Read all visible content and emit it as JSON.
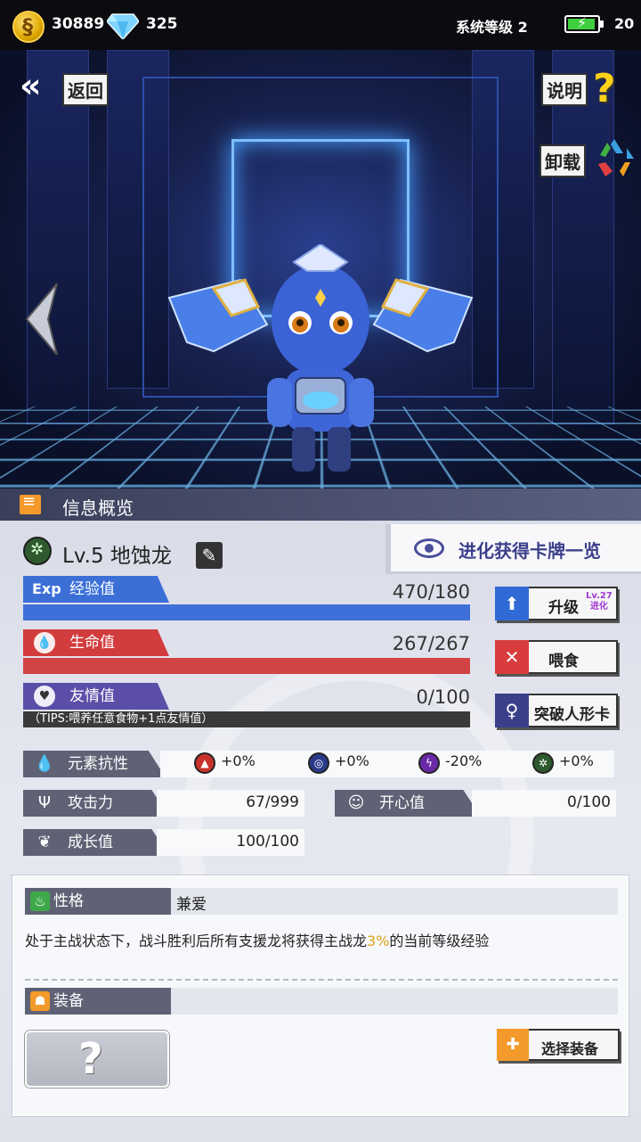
{
  "status_bar": {
    "coins": "30889",
    "gems": "325",
    "system_level": "系统等级 2",
    "battery": "20",
    "coin_icon": "gold-coin-icon",
    "gem_icon": "diamond-icon"
  },
  "scene": {
    "back_label": "返回",
    "help_label": "说明",
    "unload_label": "卸载",
    "help_icon": "question-mark-icon",
    "unload_icon": "recycle-icon"
  },
  "info": {
    "section_title": "信息概览",
    "dragon_name": "Lv.5 地蚀龙",
    "evolve_list_label": "进化获得卡牌一览",
    "exp": {
      "tag": "Exp",
      "label": "经验值",
      "value": "470/180",
      "fill_percent": 100
    },
    "hp": {
      "label": "生命值",
      "value": "267/267",
      "fill_percent": 100
    },
    "friendship": {
      "label": "友情值",
      "value": "0/100",
      "tips": "（TIPS:喂养任意食物+1点友情值）"
    },
    "buttons": {
      "upgrade": "升级",
      "upgrade_sub_1": "Lv.27",
      "upgrade_sub_2": "进化",
      "feed": "喂食",
      "breakthrough": "突破人形卡"
    },
    "resist": {
      "label": "元素抗性",
      "values": [
        "+0%",
        "+0%",
        "-20%",
        "+0%"
      ],
      "colors": [
        "#c8322a",
        "#2a3a8a",
        "#6a2aa8",
        "#2f5a2f"
      ]
    },
    "attack": {
      "label": "攻击力",
      "value": "67/999"
    },
    "happiness": {
      "label": "开心值",
      "value": "0/100"
    },
    "growth": {
      "label": "成长值",
      "value": "100/100"
    }
  },
  "trait": {
    "label": "性格",
    "value": "兼爱",
    "desc_before": "处于主战状态下，战斗胜利后所有支援龙将获得主战龙",
    "desc_highlight": "3%",
    "desc_after": "的当前等级经验"
  },
  "equip": {
    "label": "装备",
    "slot_placeholder": "?",
    "select_label": "选择装备"
  }
}
